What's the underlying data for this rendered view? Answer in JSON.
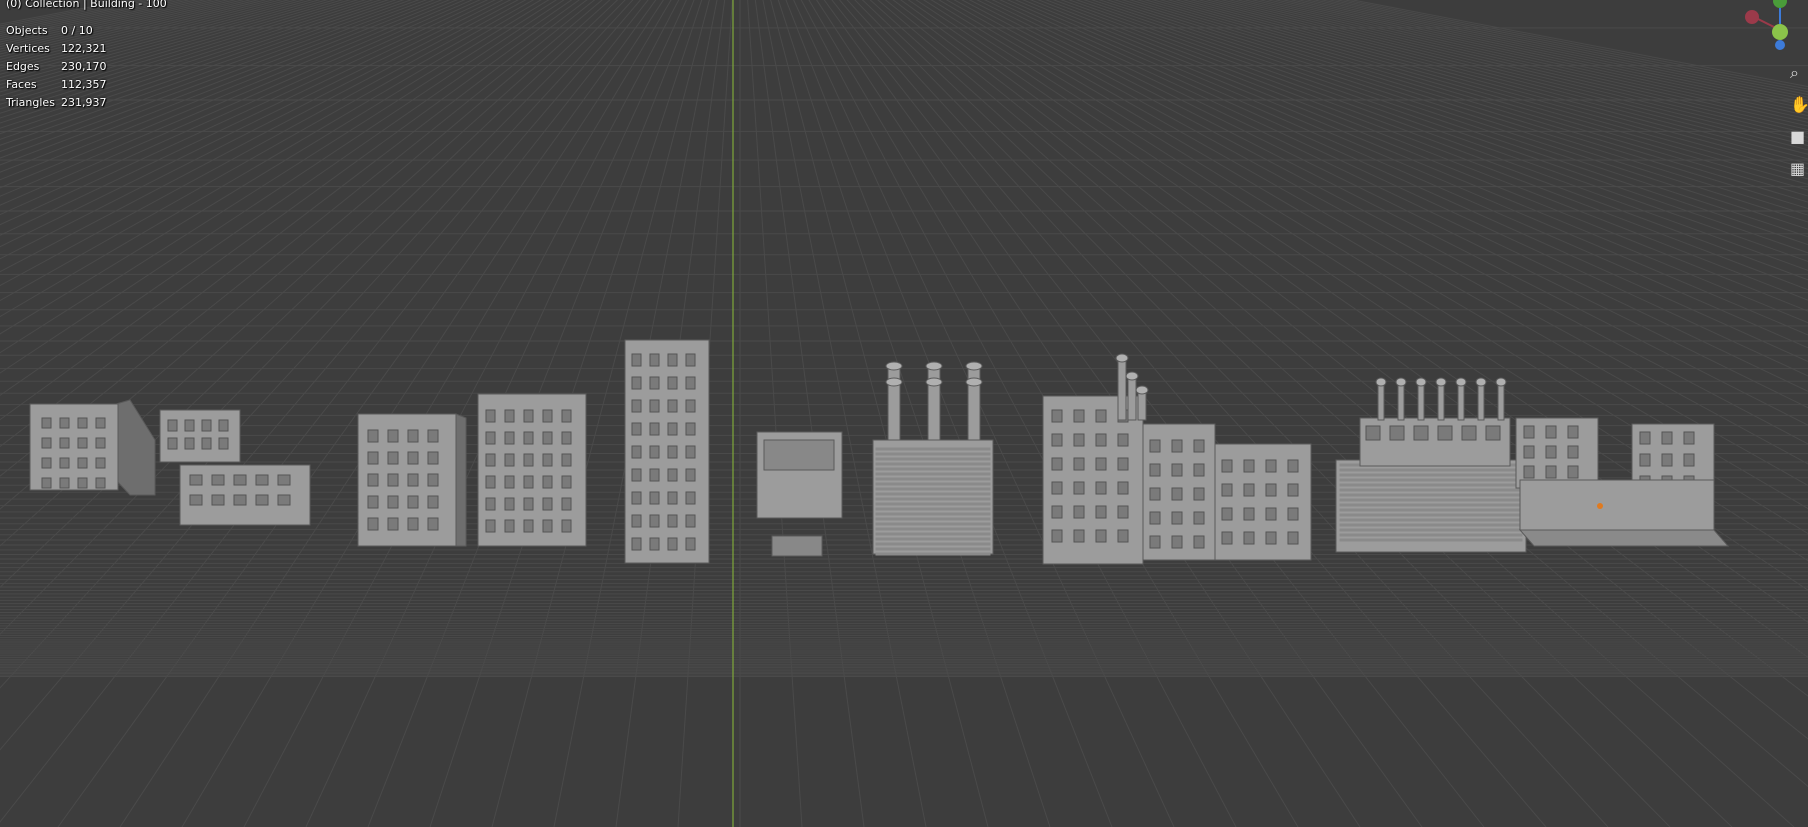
{
  "viewport": {
    "title": "(0) Collection | Building - 100",
    "stats": [
      {
        "label": "Objects",
        "value": "0 / 10"
      },
      {
        "label": "Vertices",
        "value": "122,321"
      },
      {
        "label": "Edges",
        "value": "230,170"
      },
      {
        "label": "Faces",
        "value": "112,357"
      },
      {
        "label": "Triangles",
        "value": "231,937"
      }
    ]
  },
  "gizmo": {
    "axes": [
      {
        "name": "x-axis-negative",
        "color": "#9b3a4a"
      },
      {
        "name": "y-axis",
        "color": "#8bc34a"
      },
      {
        "name": "z-axis",
        "color": "#3d7bd9"
      }
    ]
  },
  "nav_tools": [
    {
      "name": "zoom-icon",
      "glyph": "⌕"
    },
    {
      "name": "hand-pan-icon",
      "glyph": "✋"
    },
    {
      "name": "camera-icon",
      "glyph": "■"
    },
    {
      "name": "grid-view-icon",
      "glyph": "▦"
    }
  ],
  "colors": {
    "background": "#3d3d3d",
    "grid_line": "#4a4a4a",
    "y_axis_line": "#7fa83a",
    "building_light": "#9c9c9c",
    "building_dark": "#6e6e6e"
  }
}
